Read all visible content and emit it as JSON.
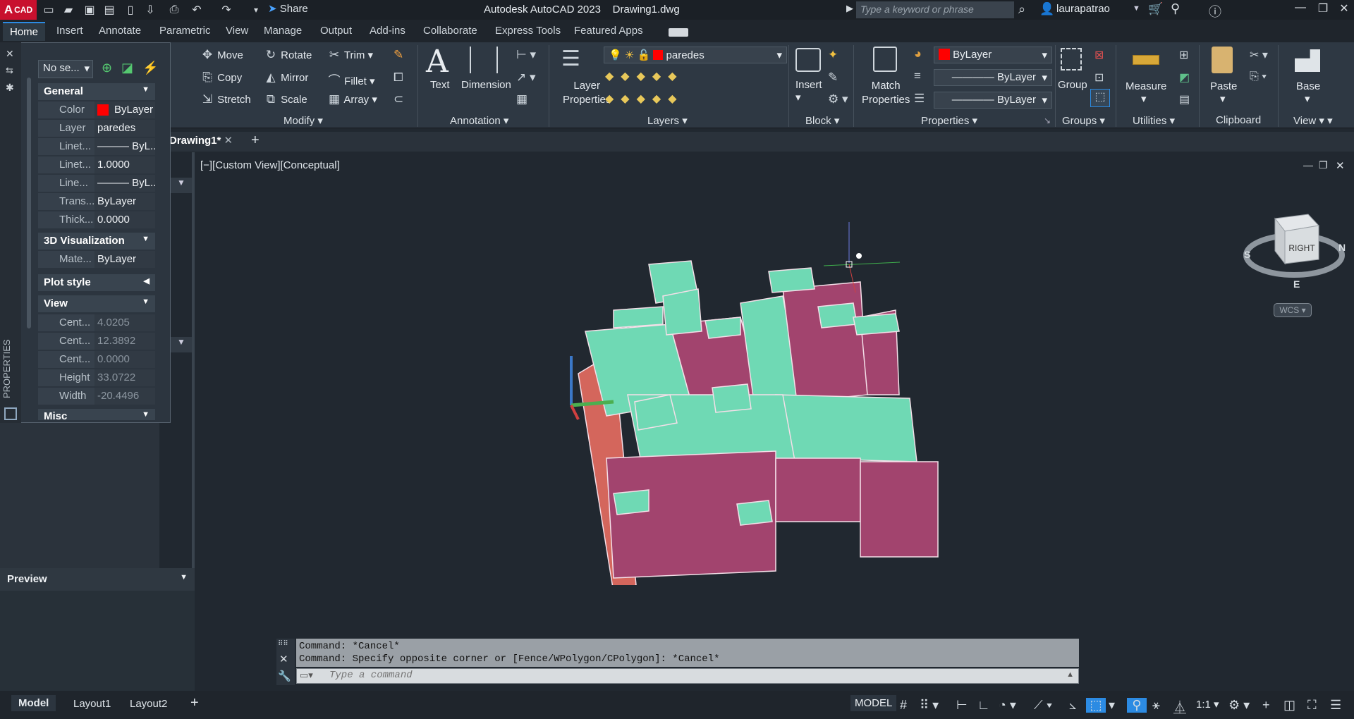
{
  "app": {
    "badge": "CAD",
    "badge_letter": "A",
    "title": "Autodesk AutoCAD 2023    Drawing1.dwg",
    "share_label": "Share",
    "search_placeholder": "Type a keyword or phrase",
    "username": "laurapatrao"
  },
  "menu_tabs": [
    "Home",
    "Insert",
    "Annotate",
    "Parametric",
    "View",
    "Manage",
    "Output",
    "Add-ins",
    "Collaborate",
    "Express Tools",
    "Featured Apps"
  ],
  "ribbon": {
    "modify": {
      "move": "Move",
      "rotate": "Rotate",
      "trim": "Trim",
      "copy": "Copy",
      "mirror": "Mirror",
      "fillet": "Fillet",
      "stretch": "Stretch",
      "scale": "Scale",
      "array": "Array",
      "title": "Modify"
    },
    "annotation": {
      "text": "Text",
      "dimension": "Dimension",
      "title": "Annotation"
    },
    "layers": {
      "layer_properties_line1": "Layer",
      "layer_properties_line2": "Properties",
      "current_layer": "paredes",
      "title": "Layers"
    },
    "block": {
      "insert": "Insert",
      "title": "Block"
    },
    "properties": {
      "match_line1": "Match",
      "match_line2": "Properties",
      "color": "ByLayer",
      "linetype": "ByLayer",
      "lineweight": "ByLayer",
      "title": "Properties"
    },
    "groups": {
      "group": "Group",
      "title": "Groups"
    },
    "utilities": {
      "measure": "Measure",
      "title": "Utilities"
    },
    "clipboard": {
      "paste": "Paste",
      "title": "Clipboard"
    },
    "view": {
      "base": "Base",
      "title": "View"
    }
  },
  "file_tabs": {
    "doc": "Drawing1*"
  },
  "properties_palette": {
    "selection": "No se...",
    "vertical_title": "PROPERTIES",
    "sections": {
      "general": "General",
      "viz": "3D Visualization",
      "plot": "Plot style",
      "view": "View",
      "misc": "Misc"
    },
    "general_rows": [
      {
        "name": "Color",
        "value": "ByLayer"
      },
      {
        "name": "Layer",
        "value": "paredes"
      },
      {
        "name": "Linet...",
        "value": "——— ByL..."
      },
      {
        "name": "Linet...",
        "value": "1.0000"
      },
      {
        "name": "Line...",
        "value": "——— ByL..."
      },
      {
        "name": "Trans...",
        "value": "ByLayer"
      },
      {
        "name": "Thick...",
        "value": "0.0000"
      }
    ],
    "viz_rows": [
      {
        "name": "Mate...",
        "value": "ByLayer"
      }
    ],
    "view_rows": [
      {
        "name": "Cent...",
        "value": "4.0205"
      },
      {
        "name": "Cent...",
        "value": "12.3892"
      },
      {
        "name": "Cent...",
        "value": "0.0000"
      },
      {
        "name": "Height",
        "value": "33.0722"
      },
      {
        "name": "Width",
        "value": "-20.4496"
      }
    ]
  },
  "preview": {
    "title": "Preview"
  },
  "viewport": {
    "controls": "[−][Custom View][Conceptual]",
    "viewcube_face": "RIGHT",
    "compass": {
      "n": "N",
      "s": "S",
      "e": "E"
    },
    "wcs": "WCS"
  },
  "command": {
    "history": [
      "Command: *Cancel*",
      "Command: Specify opposite corner or [Fence/WPolygon/CPolygon]: *Cancel*"
    ],
    "placeholder": "Type a command"
  },
  "status": {
    "tabs": [
      "Model",
      "Layout1",
      "Layout2"
    ],
    "space": "MODEL",
    "scale": "1:1"
  },
  "colors": {
    "accent": "#2c8be3",
    "wall_face": "#a2446e",
    "top_face": "#6fd9b4",
    "side_face": "#d4665c",
    "layer_color": "#ff0000"
  }
}
